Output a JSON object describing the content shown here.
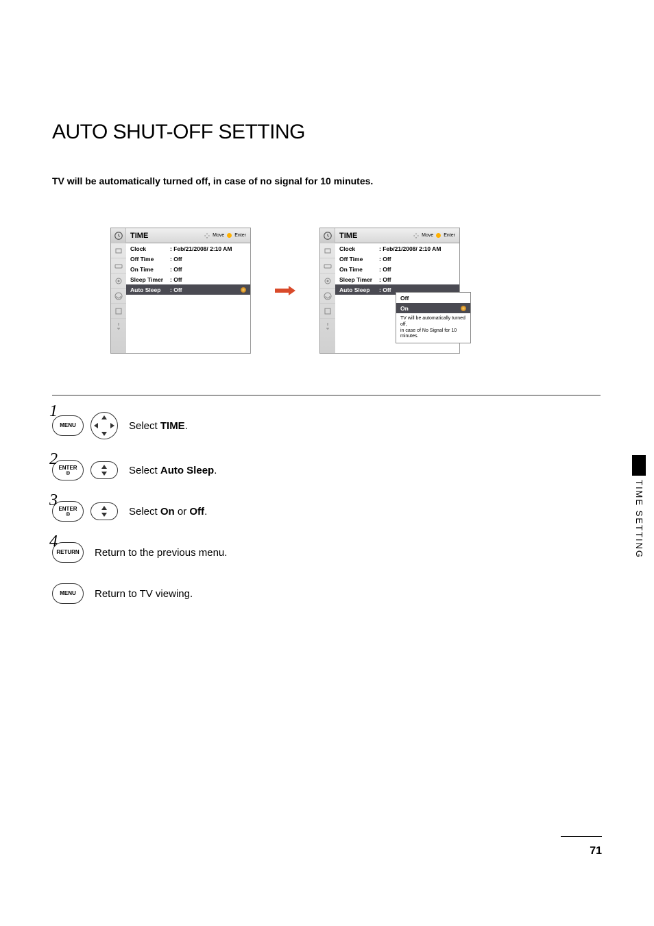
{
  "title": "AUTO SHUT-OFF SETTING",
  "description": "TV will be automatically turned off, in case of no signal for 10 minutes.",
  "side_label": "TIME SETTING",
  "page_number": "71",
  "osd": {
    "header_title": "TIME",
    "hint_move": "Move",
    "hint_enter": "Enter",
    "rows": [
      {
        "label": "Clock",
        "value": "Feb/21/2008/  2:10 AM"
      },
      {
        "label": "Off Time",
        "value": "Off"
      },
      {
        "label": "On Time",
        "value": "Off"
      },
      {
        "label": "Sleep Timer",
        "value": "Off"
      },
      {
        "label": "Auto Sleep",
        "value": "Off"
      }
    ]
  },
  "popup": {
    "options": [
      "Off",
      "On"
    ],
    "note_line1": "TV will be automatically turned off,",
    "note_line2": "in case of No Signal for 10 minutes."
  },
  "buttons": {
    "menu": "MENU",
    "enter": "ENTER",
    "return": "RETURN"
  },
  "steps": {
    "s1_num": "1",
    "s1_pre": "Select ",
    "s1_bold": "TIME",
    "s1_post": ".",
    "s2_num": "2",
    "s2_pre": "Select ",
    "s2_bold": "Auto Sleep",
    "s2_post": ".",
    "s3_num": "3",
    "s3_pre": "Select ",
    "s3_bold1": "On",
    "s3_mid": " or ",
    "s3_bold2": "Off",
    "s3_post": ".",
    "s4_num": "4",
    "s4_text": "Return to the previous menu.",
    "s5_text": "Return to TV viewing."
  }
}
